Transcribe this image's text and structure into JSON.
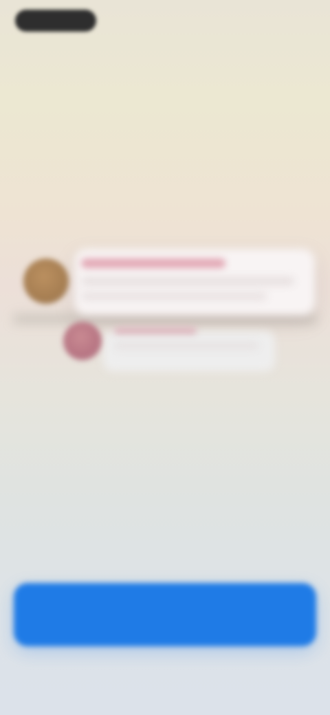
{
  "status_bar": {
    "time": "",
    "right": ""
  },
  "notifications": [
    {
      "title": "",
      "line1": "",
      "line2": ""
    },
    {
      "title": "",
      "line1": ""
    }
  ],
  "intro": {
    "title": "",
    "subtitle": ""
  },
  "cta": {
    "label": ""
  },
  "colors": {
    "accent": "#1f7be6",
    "avatar_1": "#a67e52",
    "avatar_2": "#b77583",
    "notification_title": "#e2a7b4"
  }
}
